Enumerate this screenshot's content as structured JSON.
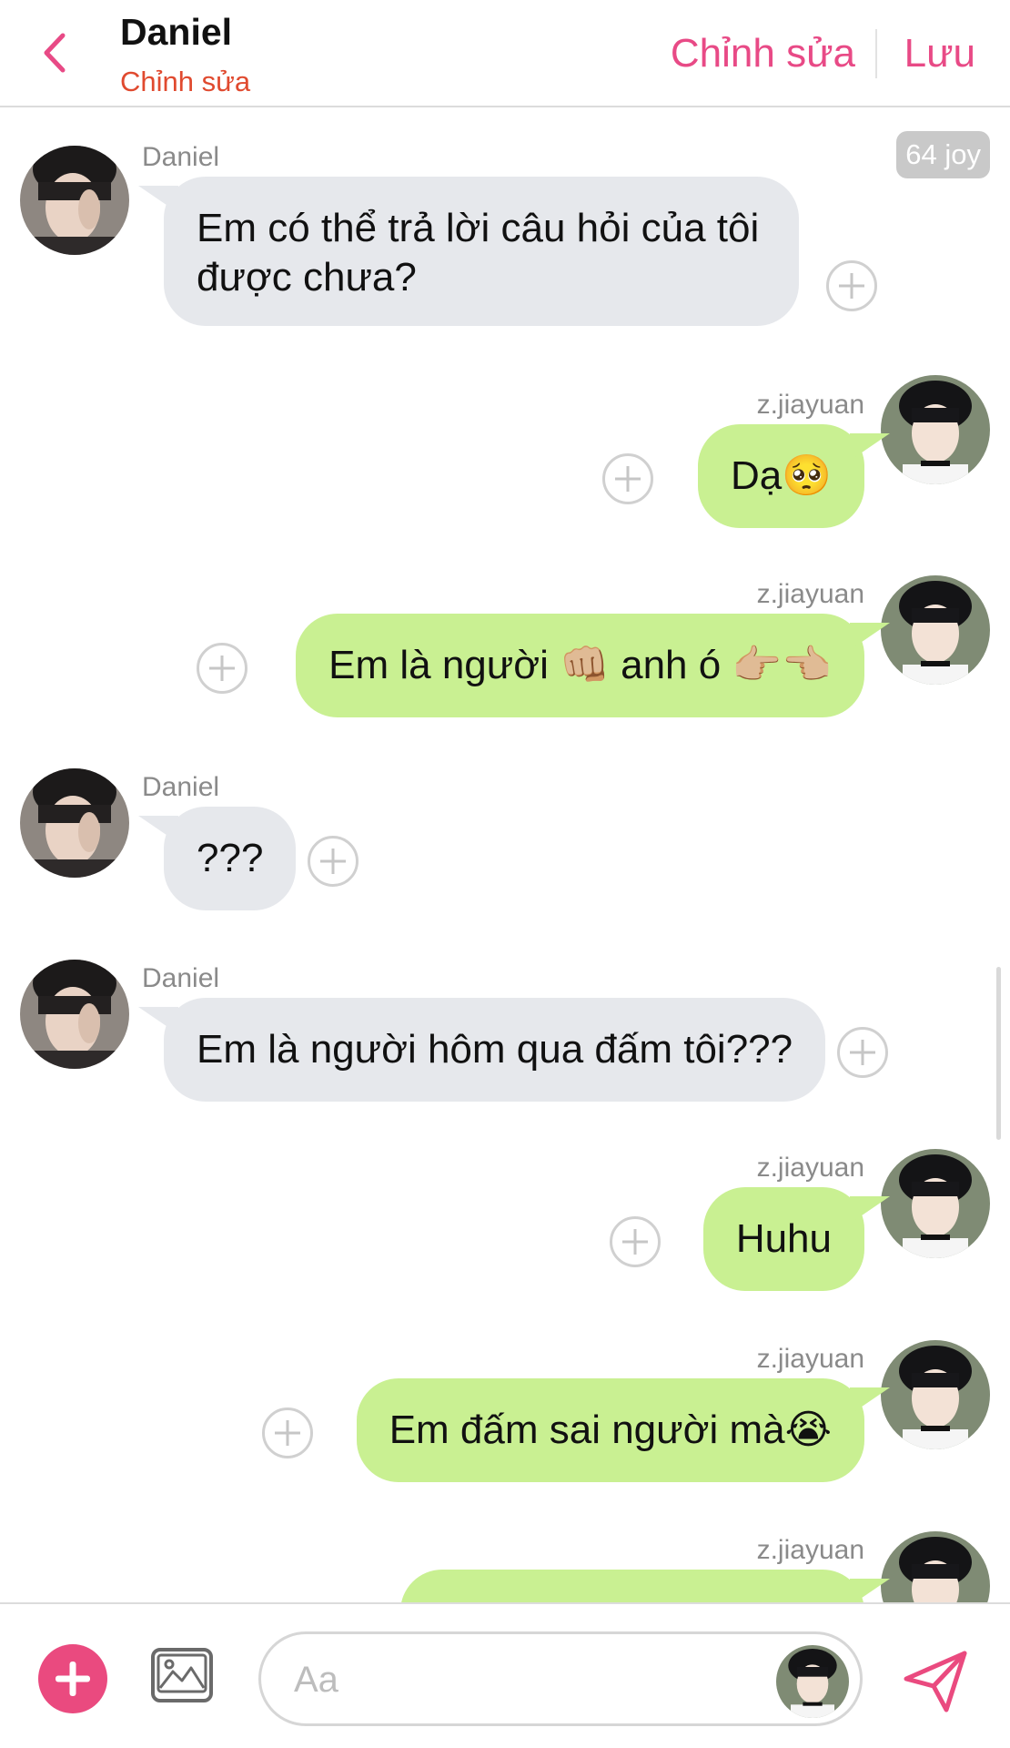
{
  "header": {
    "title": "Daniel",
    "subtitle": "Chỉnh sửa",
    "edit_label": "Chỉnh sửa",
    "save_label": "Lưu"
  },
  "token_badge": "64 joy",
  "messages": [
    {
      "side": "left",
      "sender": "Daniel",
      "text": "Em có thể trả lời câu hỏi của tôi được chưa?"
    },
    {
      "side": "right",
      "sender": "z.jiayuan",
      "text": "Dạ🥺"
    },
    {
      "side": "right",
      "sender": "z.jiayuan",
      "text": "Em là người 👊🏼 anh ó 👉🏼👈🏼"
    },
    {
      "side": "left",
      "sender": "Daniel",
      "text": "???"
    },
    {
      "side": "left",
      "sender": "Daniel",
      "text": "Em là người hôm qua đấm tôi???"
    },
    {
      "side": "right",
      "sender": "z.jiayuan",
      "text": "Huhu"
    },
    {
      "side": "right",
      "sender": "z.jiayuan",
      "text": "Em đấm sai người mà😭"
    },
    {
      "side": "right",
      "sender": "z.jiayuan",
      "text": ""
    }
  ],
  "composer": {
    "placeholder": "Aa"
  },
  "colors": {
    "accent": "#ea4a7f",
    "subtitle": "#e04a2f",
    "incoming_bubble": "#e6e8ec",
    "outgoing_bubble": "#c9f092"
  },
  "icons": {
    "back": "chevron-left-icon",
    "add_reaction": "plus-circle-icon",
    "attach": "plus-icon",
    "image": "image-icon",
    "send": "send-icon"
  }
}
